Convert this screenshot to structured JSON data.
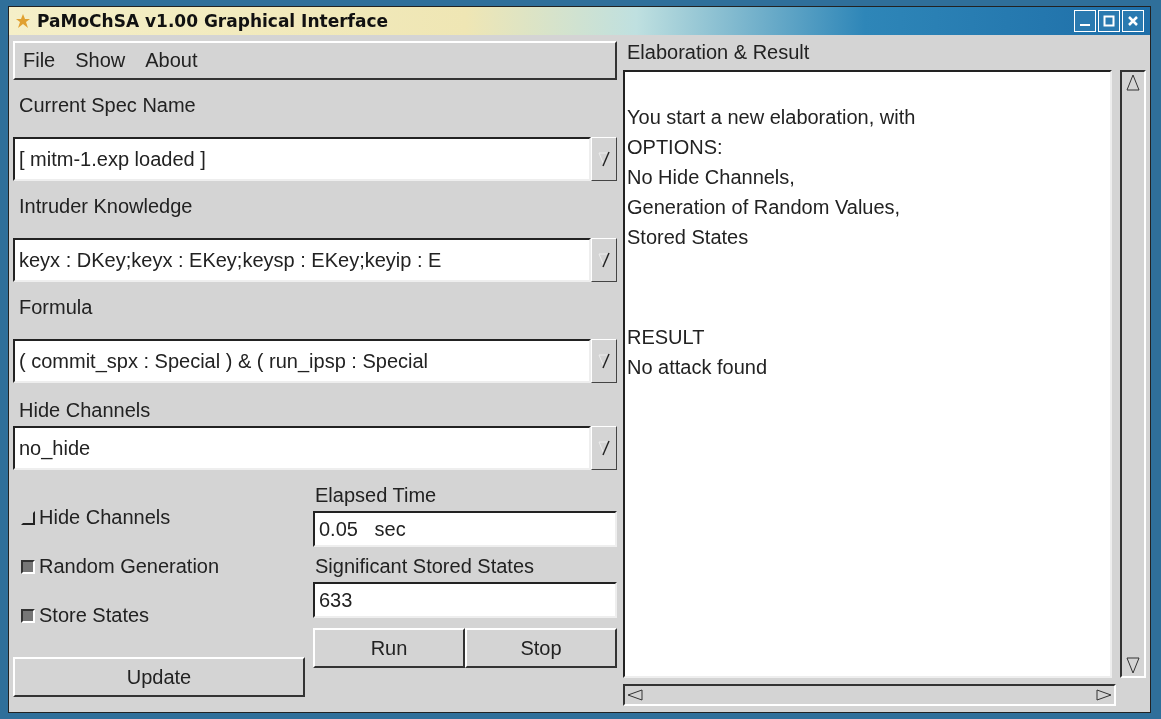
{
  "window": {
    "title": "PaMoChSA v1.00 Graphical Interface"
  },
  "menu": [
    "File",
    "Show",
    "About"
  ],
  "combos": [
    {
      "label": "Current Spec Name",
      "value": "[ mitm-1.exp loaded ]"
    },
    {
      "label": "Intruder Knowledge",
      "value": "keyx : DKey;keyx : EKey;keysp : EKey;keyip : E"
    },
    {
      "label": "Formula",
      "value": "( commit_spx : Special ) & ( run_ipsp : Special"
    },
    {
      "label": "Hide Channels",
      "value": "no_hide"
    }
  ],
  "options": [
    {
      "label": "Hide Channels",
      "checked": false
    },
    {
      "label": "Random Generation",
      "checked": true
    },
    {
      "label": "Store States",
      "checked": true
    }
  ],
  "elapsed": {
    "label": "Elapsed Time",
    "value": "0.05   sec"
  },
  "stored": {
    "label": "Significant Stored States",
    "value": "633"
  },
  "buttons": {
    "update": "Update",
    "run": "Run",
    "stop": "Stop"
  },
  "output": {
    "title": "Elaboration & Result",
    "lines": [
      "You start a new elaboration, with",
      "OPTIONS:",
      "No Hide Channels,",
      "Generation of Random Values,",
      "Stored States"
    ],
    "result": [
      "RESULT",
      "No attack found"
    ]
  }
}
